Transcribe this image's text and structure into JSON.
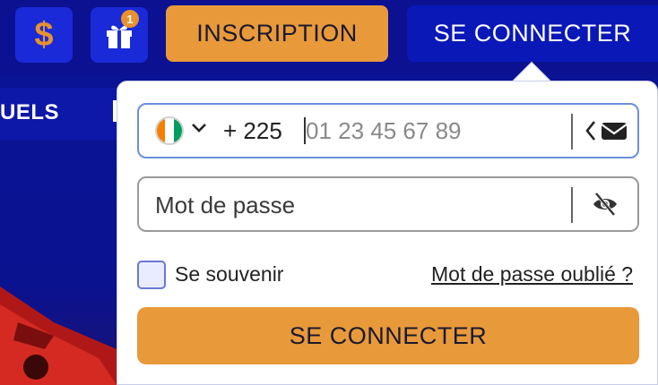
{
  "header": {
    "currency_icon": "dollar-icon",
    "gift_icon": "gift-icon",
    "gift_badge": "1",
    "signup_label": "INSCRIPTION",
    "login_label": "SE CONNECTER",
    "dollar_glyph": "$"
  },
  "subnav": {
    "partial_label": "UELS"
  },
  "login_form": {
    "country_flag": "cote-divoire-flag",
    "dial_code": "+ 225",
    "phone_placeholder": "01 23 45 67 89",
    "switch_icon": "envelope-icon",
    "password_placeholder": "Mot de passe",
    "password_toggle_icon": "eye-off-icon",
    "remember_label": "Se souvenir",
    "forgot_label": "Mot de passe oublié ?",
    "submit_label": "SE CONNECTER"
  },
  "colors": {
    "brand_blue": "#0a1394",
    "accent_orange": "#e8993a",
    "field_focus": "#6b8fe0"
  }
}
